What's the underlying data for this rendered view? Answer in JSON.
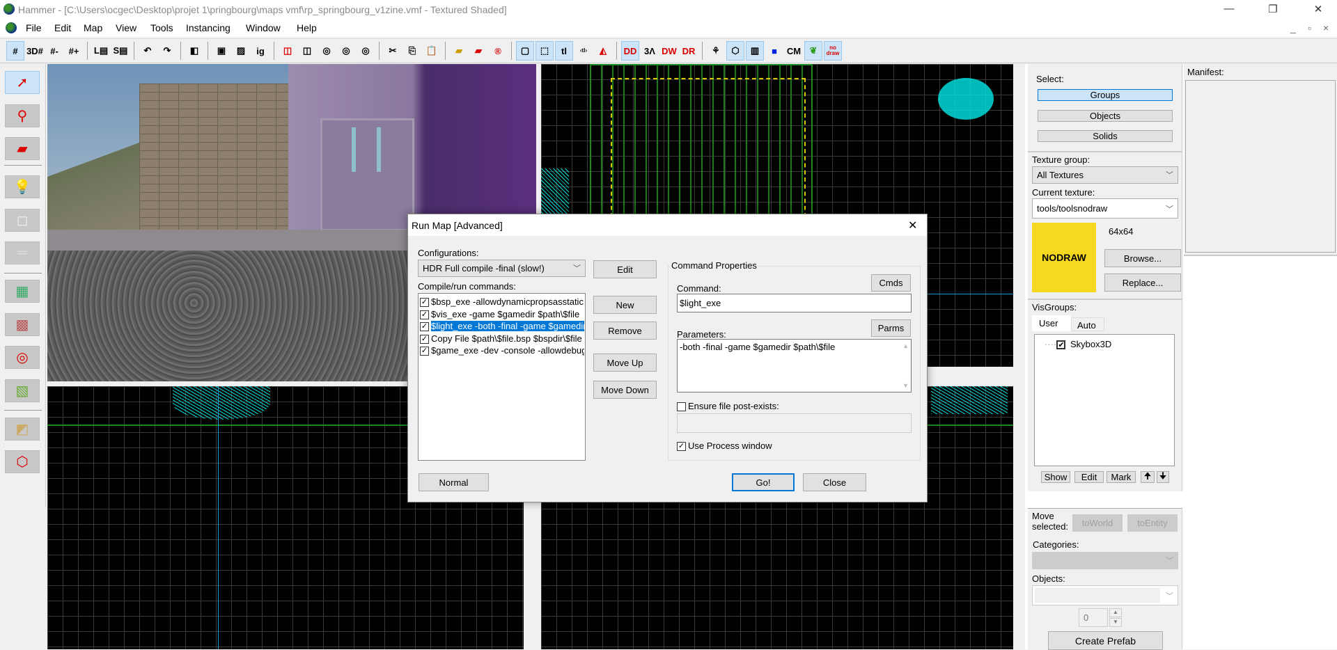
{
  "window": {
    "title": "Hammer - [C:\\Users\\ocgec\\Desktop\\projet 1\\pringbourg\\maps vmf\\rp_springbourg_v1zine.vmf - Textured Shaded]",
    "minimize": "—",
    "restore": "❐",
    "close": "✕"
  },
  "menu": {
    "items": [
      "File",
      "Edit",
      "Map",
      "View",
      "Tools",
      "Instancing",
      "Window",
      "Help"
    ],
    "mdi": [
      "_",
      "▫",
      "×"
    ]
  },
  "toolbar": {
    "items": [
      {
        "icon": "grid-icon",
        "glyph": "#",
        "on": true
      },
      {
        "icon": "3d-grid-icon",
        "glyph": "3D#"
      },
      {
        "icon": "smaller-grid-icon",
        "glyph": "#-"
      },
      {
        "icon": "larger-grid-icon",
        "glyph": "#+"
      },
      {
        "sep": true
      },
      {
        "icon": "load-window-state-icon",
        "glyph": "L▤"
      },
      {
        "icon": "save-window-state-icon",
        "glyph": "S▤"
      },
      {
        "sep": true
      },
      {
        "icon": "undo-icon",
        "glyph": "↶"
      },
      {
        "icon": "redo-icon",
        "glyph": "↷"
      },
      {
        "sep": true
      },
      {
        "icon": "carve-icon",
        "glyph": "◧"
      },
      {
        "sep": true
      },
      {
        "icon": "group-icon",
        "glyph": "▣"
      },
      {
        "icon": "ungroup-icon",
        "glyph": "▨"
      },
      {
        "icon": "ignore-group-icon",
        "glyph": "ig"
      },
      {
        "sep": true
      },
      {
        "icon": "hide-selected-icon",
        "glyph": "◫",
        "color": "#d00"
      },
      {
        "icon": "hide-unselected-icon",
        "glyph": "◫"
      },
      {
        "icon": "show-all-icon",
        "glyph": "◎"
      },
      {
        "icon": "quick-hide-icon",
        "glyph": "◎"
      },
      {
        "icon": "unhide-icon",
        "glyph": "◎"
      },
      {
        "sep": true
      },
      {
        "icon": "cut-icon",
        "glyph": "✂"
      },
      {
        "icon": "copy-icon",
        "glyph": "⎘"
      },
      {
        "icon": "paste-icon",
        "glyph": "📋"
      },
      {
        "sep": true
      },
      {
        "icon": "texture-lock-icon",
        "glyph": "▰",
        "color": "#c9a000"
      },
      {
        "icon": "texture-scale-lock-icon",
        "glyph": "▰",
        "color": "#d00"
      },
      {
        "icon": "entity-report-icon",
        "glyph": "®",
        "color": "#d00"
      },
      {
        "sep": true
      },
      {
        "icon": "wireframe-box-icon",
        "glyph": "▢",
        "on": true
      },
      {
        "icon": "select-box-icon",
        "glyph": "⬚",
        "on": true
      },
      {
        "icon": "tl-icon",
        "glyph": "tl",
        "on": true
      },
      {
        "icon": "tl-expand-icon",
        "glyph": "‹tl›"
      },
      {
        "icon": "flip-icon",
        "glyph": "◭",
        "color": "#d00"
      },
      {
        "sep": true
      },
      {
        "icon": "displacement-icon",
        "glyph": "DD",
        "color": "#d00",
        "on": true
      },
      {
        "icon": "3d-alpha-icon",
        "glyph": "3Λ"
      },
      {
        "icon": "dw-icon",
        "glyph": "DW",
        "color": "#d00"
      },
      {
        "icon": "dr-icon",
        "glyph": "DR",
        "color": "#d00"
      },
      {
        "sep": true
      },
      {
        "icon": "helper-icon",
        "glyph": "⚘"
      },
      {
        "icon": "models-icon",
        "glyph": "⬡",
        "on": true
      },
      {
        "icon": "cordon-icon",
        "glyph": "▥",
        "on": true
      },
      {
        "icon": "blue-squares-icon",
        "glyph": "■",
        "color": "#0020e0"
      },
      {
        "icon": "cm-icon",
        "glyph": "CM"
      },
      {
        "icon": "leaf-icon",
        "glyph": "❦",
        "color": "#2a9a1a",
        "on": true
      },
      {
        "icon": "nodraw-icon",
        "glyph": "no draw",
        "color": "#d00",
        "on": true
      }
    ]
  },
  "left_tools": [
    "selection-tool-icon",
    "magnify-tool-icon",
    "camera-tool-icon",
    "entity-tool-icon",
    "block-tool-icon",
    "decal-tool-icon",
    "texture-application-icon",
    "apply-texture-icon",
    "overlay-tool-icon",
    "clip-tool-icon",
    "texture-face-icon",
    "vertex-tool-icon"
  ],
  "dialog": {
    "title": "Run Map [Advanced]",
    "close": "✕",
    "configurations_label": "Configurations:",
    "configuration": "HDR Full compile -final (slow!)",
    "edit": "Edit",
    "commands_label": "Compile/run commands:",
    "commands": [
      {
        "text": "$bsp_exe -allowdynamicpropsasstatic",
        "checked": true
      },
      {
        "text": "$vis_exe -game $gamedir $path\\$file",
        "checked": true
      },
      {
        "text": "$light_exe -both -final -game $gamedir",
        "checked": true,
        "selected": true
      },
      {
        "text": "Copy File $path\\$file.bsp $bspdir\\$file",
        "checked": true
      },
      {
        "text": "$game_exe -dev -console -allowdebug",
        "checked": true
      }
    ],
    "new": "New",
    "remove": "Remove",
    "move_up": "Move Up",
    "move_down": "Move Down",
    "props_title": "Command Properties",
    "command_label": "Command:",
    "cmds": "Cmds",
    "command_value": "$light_exe",
    "parameters_label": "Parameters:",
    "parms": "Parms",
    "parameters_value": "-both -final -game $gamedir $path\\$file",
    "ensure_label": "Ensure file post-exists:",
    "ensure_checked": false,
    "ensure_value": "",
    "process_label": "Use Process window",
    "process_checked": true,
    "normal": "Normal",
    "go": "Go!",
    "close_btn": "Close"
  },
  "right_panel": {
    "select_label": "Select:",
    "groups": "Groups",
    "objects": "Objects",
    "solids": "Solids",
    "texture_group_label": "Texture group:",
    "texture_group": "All Textures",
    "current_texture_label": "Current texture:",
    "current_texture": "tools/toolsnodraw",
    "preview_text": "NODRAW",
    "preview_color": "#f5d820",
    "size": "64x64",
    "browse": "Browse...",
    "replace": "Replace...",
    "visgroups_label": "VisGroups:",
    "tabs": [
      "User",
      "Auto"
    ],
    "visgroup_item": "Skybox3D",
    "show": "Show",
    "edit": "Edit",
    "mark": "Mark",
    "up": "🠉",
    "down": "🠋",
    "manifest_label": "Manifest:",
    "move_selected_label": "Move selected:",
    "to_world": "toWorld",
    "to_entity": "toEntity",
    "categories_label": "Categories:",
    "objects_label": "Objects:",
    "count": "0",
    "create_prefab": "Create Prefab"
  }
}
